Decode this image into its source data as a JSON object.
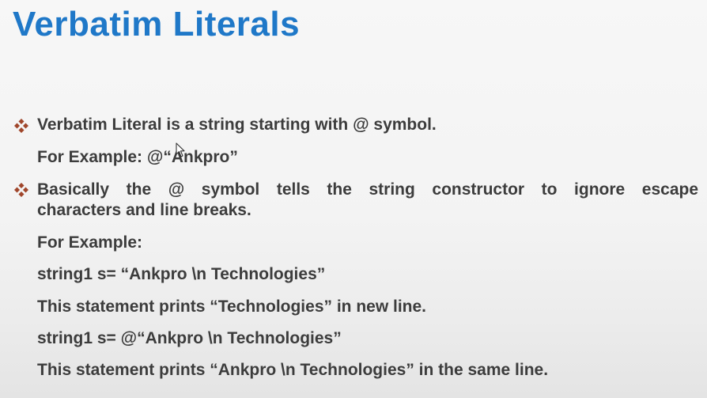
{
  "slide": {
    "title": "Verbatim Literals",
    "bullet1": {
      "text": "Verbatim Literal is a string starting with @ symbol.",
      "example": "For Example: @“Ankpro”"
    },
    "bullet2": {
      "text_line1": "Basically the @ symbol tells the string constructor to ignore escape",
      "text_line2": "characters and line breaks.",
      "example_label": "For Example:",
      "code1": "string1 s= “Ankpro \\n Technologies”",
      "note1": "This statement prints “Technologies” in new line.",
      "code2": "string1 s= @“Ankpro \\n Technologies”",
      "note2": "This statement prints “Ankpro \\n Technologies” in the same line."
    }
  },
  "colors": {
    "title": "#1f78c8",
    "bullet": "#a0462b",
    "text": "#3c3c3c"
  },
  "icons": {
    "bullet": "four-diamond-bullet-icon",
    "cursor": "mouse-pointer-icon"
  }
}
